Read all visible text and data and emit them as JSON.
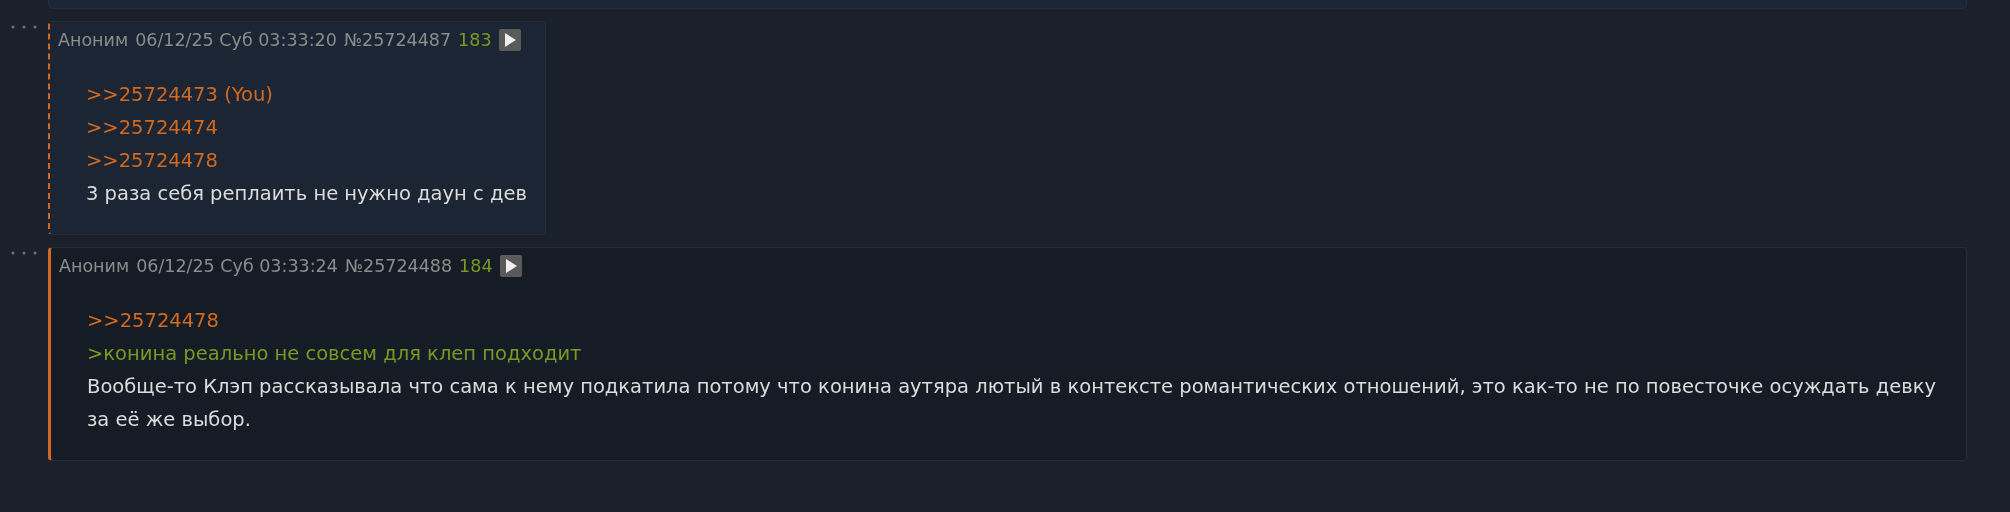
{
  "posts": [
    {
      "author": "Аноним",
      "date": "06/12/25 Суб 03:33:20",
      "number": "№25724487",
      "ordinal": "183",
      "highlighted": true,
      "lines": [
        {
          "kind": "reply",
          "text": ">>25724473 (You)"
        },
        {
          "kind": "reply",
          "text": ">>25724474"
        },
        {
          "kind": "reply",
          "text": ">>25724478"
        },
        {
          "kind": "text",
          "text": "3 раза себя реплаить не нужно даун с дев"
        }
      ]
    },
    {
      "author": "Аноним",
      "date": "06/12/25 Суб 03:33:24",
      "number": "№25724488",
      "ordinal": "184",
      "highlighted": false,
      "lines": [
        {
          "kind": "reply",
          "text": ">>25724478"
        },
        {
          "kind": "quote",
          "text": ">конина реально не совсем для клеп подходит"
        },
        {
          "kind": "text",
          "text": "Вообще-то Клэп рассказывала что сама к нему подкатила потому что конина аутяра лютый в контексте романтических отношений, это как-то не по повесточке осуждать девку за её же выбор."
        }
      ]
    }
  ]
}
